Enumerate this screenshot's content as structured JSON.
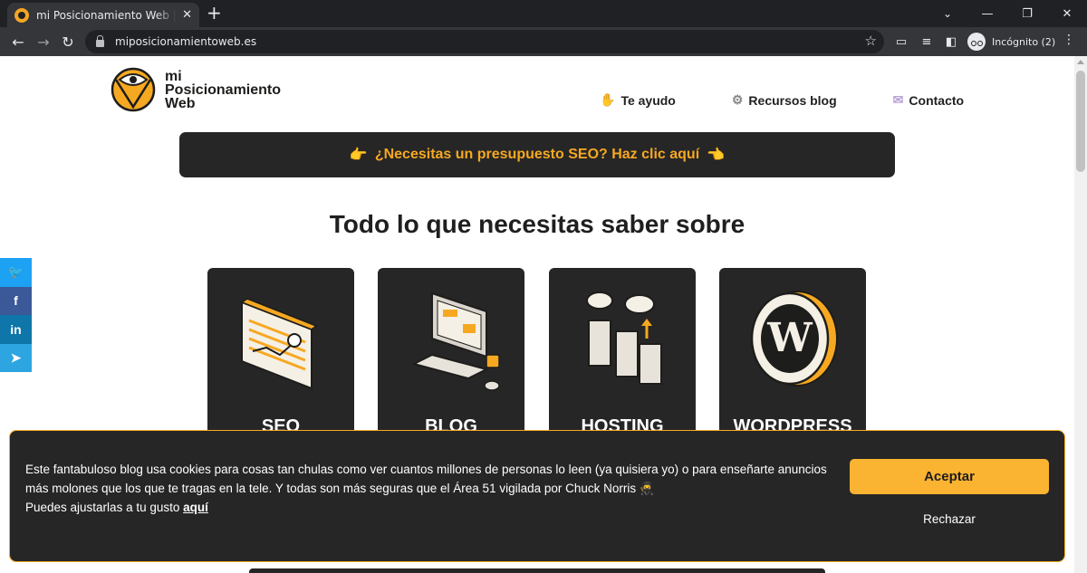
{
  "browser": {
    "tab_title": "mi Posicionamiento Web | Blog de",
    "url": "miposicionamientoweb.es",
    "profile_label": "Incógnito (2)"
  },
  "site": {
    "logo_line1": "mi",
    "logo_line2": "Posicionamiento",
    "logo_line3": "Web",
    "nav": [
      {
        "label": "Te ayudo",
        "icon": "helping-hand-icon"
      },
      {
        "label": "Recursos blog",
        "icon": "gear-icon"
      },
      {
        "label": "Contacto",
        "icon": "envelope-icon"
      }
    ],
    "cta": "¿Necesitas un presupuesto SEO? Haz clic aquí",
    "heading": "Todo lo que necesitas saber sobre",
    "cards": [
      "SEO",
      "BLOG",
      "HOSTING",
      "WORDPRESS"
    ],
    "social": [
      {
        "icon": "twitter-icon",
        "glyph": "🐦",
        "color": "#1da1f2"
      },
      {
        "icon": "facebook-icon",
        "glyph": "f",
        "color": "#3b5998"
      },
      {
        "icon": "linkedin-icon",
        "glyph": "in",
        "color": "#0e76a8"
      },
      {
        "icon": "telegram-icon",
        "glyph": "➤",
        "color": "#2ca5e0"
      }
    ]
  },
  "cookie": {
    "text_line1": "Este fantabuloso blog usa cookies para cosas tan chulas como ver cuantos millones de personas lo leen (ya quisiera yo) o para enseñarte anuncios",
    "text_line2": "más molones que los que te tragas en la tele. Y todas son más seguras que el Área 51 vigilada por Chuck Norris",
    "text_line3": "Puedes ajustarlas a tu gusto",
    "link": "aquí",
    "accept": "Aceptar",
    "reject": "Rechazar"
  },
  "colors": {
    "accent": "#f6a821",
    "dark": "#262626"
  }
}
